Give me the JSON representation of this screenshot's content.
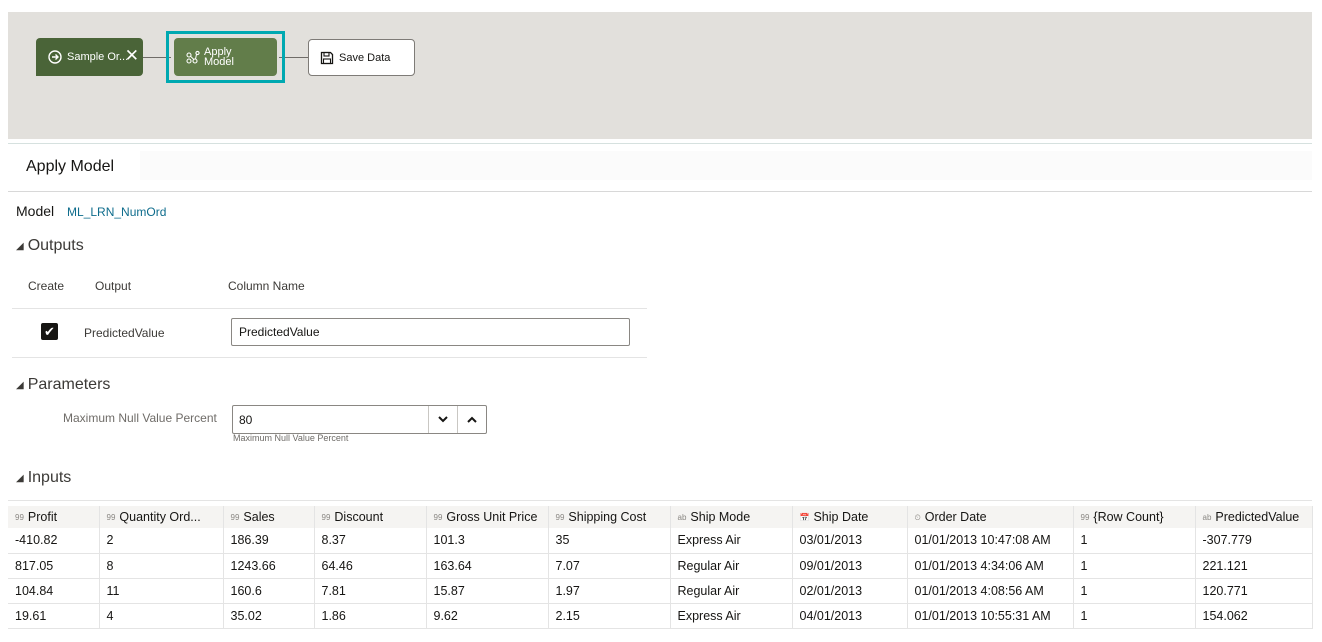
{
  "flow": {
    "nodes": [
      {
        "label": "Sample Or...",
        "icon": "arrow-circle-right-icon",
        "close_icon": "✕"
      },
      {
        "label_line1": "Apply",
        "label_line2": "Model",
        "icon": "model-nodes-icon"
      },
      {
        "label": "Save Data",
        "icon": "floppy-disk-icon"
      }
    ],
    "accent_selected": "#00a9b1",
    "node_dark": "#4a6438",
    "node_selected": "#627d4a"
  },
  "panel": {
    "title": "Apply Model",
    "model_label": "Model",
    "model_value": "ML_LRN_NumOrd"
  },
  "outputs": {
    "heading": "Outputs",
    "col_create": "Create",
    "col_output": "Output",
    "col_column_name": "Column Name",
    "rows": [
      {
        "checked": true,
        "checkmark": "✔",
        "output": "PredictedValue",
        "column_name": "PredictedValue"
      }
    ]
  },
  "parameters": {
    "heading": "Parameters",
    "label": "Maximum Null Value Percent",
    "value": "80",
    "help": "Maximum Null Value Percent",
    "decrement": "⌄",
    "increment": "⌃"
  },
  "inputs": {
    "heading": "Inputs",
    "columns": [
      {
        "type_icon": "99",
        "name": "Profit"
      },
      {
        "type_icon": "99",
        "name": "Quantity Ord..."
      },
      {
        "type_icon": "99",
        "name": "Sales"
      },
      {
        "type_icon": "99",
        "name": "Discount"
      },
      {
        "type_icon": "99",
        "name": "Gross Unit Price"
      },
      {
        "type_icon": "99",
        "name": "Shipping Cost"
      },
      {
        "type_icon": "ab",
        "name": "Ship Mode"
      },
      {
        "type_icon": "📅",
        "name": "Ship Date"
      },
      {
        "type_icon": "⏲",
        "name": "Order Date"
      },
      {
        "type_icon": "99",
        "name": "{Row Count}"
      },
      {
        "type_icon": "ab",
        "name": "PredictedValue"
      }
    ],
    "rows": [
      [
        "-410.82",
        "2",
        "186.39",
        "8.37",
        "101.3",
        "35",
        "Express Air",
        "03/01/2013",
        "01/01/2013 10:47:08 AM",
        "1",
        "-307.779"
      ],
      [
        "817.05",
        "8",
        "1243.66",
        "64.46",
        "163.64",
        "7.07",
        "Regular Air",
        "09/01/2013",
        "01/01/2013 4:34:06 AM",
        "1",
        "221.121"
      ],
      [
        "104.84",
        "11",
        "160.6",
        "7.81",
        "15.87",
        "1.97",
        "Regular Air",
        "02/01/2013",
        "01/01/2013 4:08:56 AM",
        "1",
        "120.771"
      ],
      [
        "19.61",
        "4",
        "35.02",
        "1.86",
        "9.62",
        "2.15",
        "Express Air",
        "04/01/2013",
        "01/01/2013 10:55:31 AM",
        "1",
        "154.062"
      ]
    ]
  }
}
